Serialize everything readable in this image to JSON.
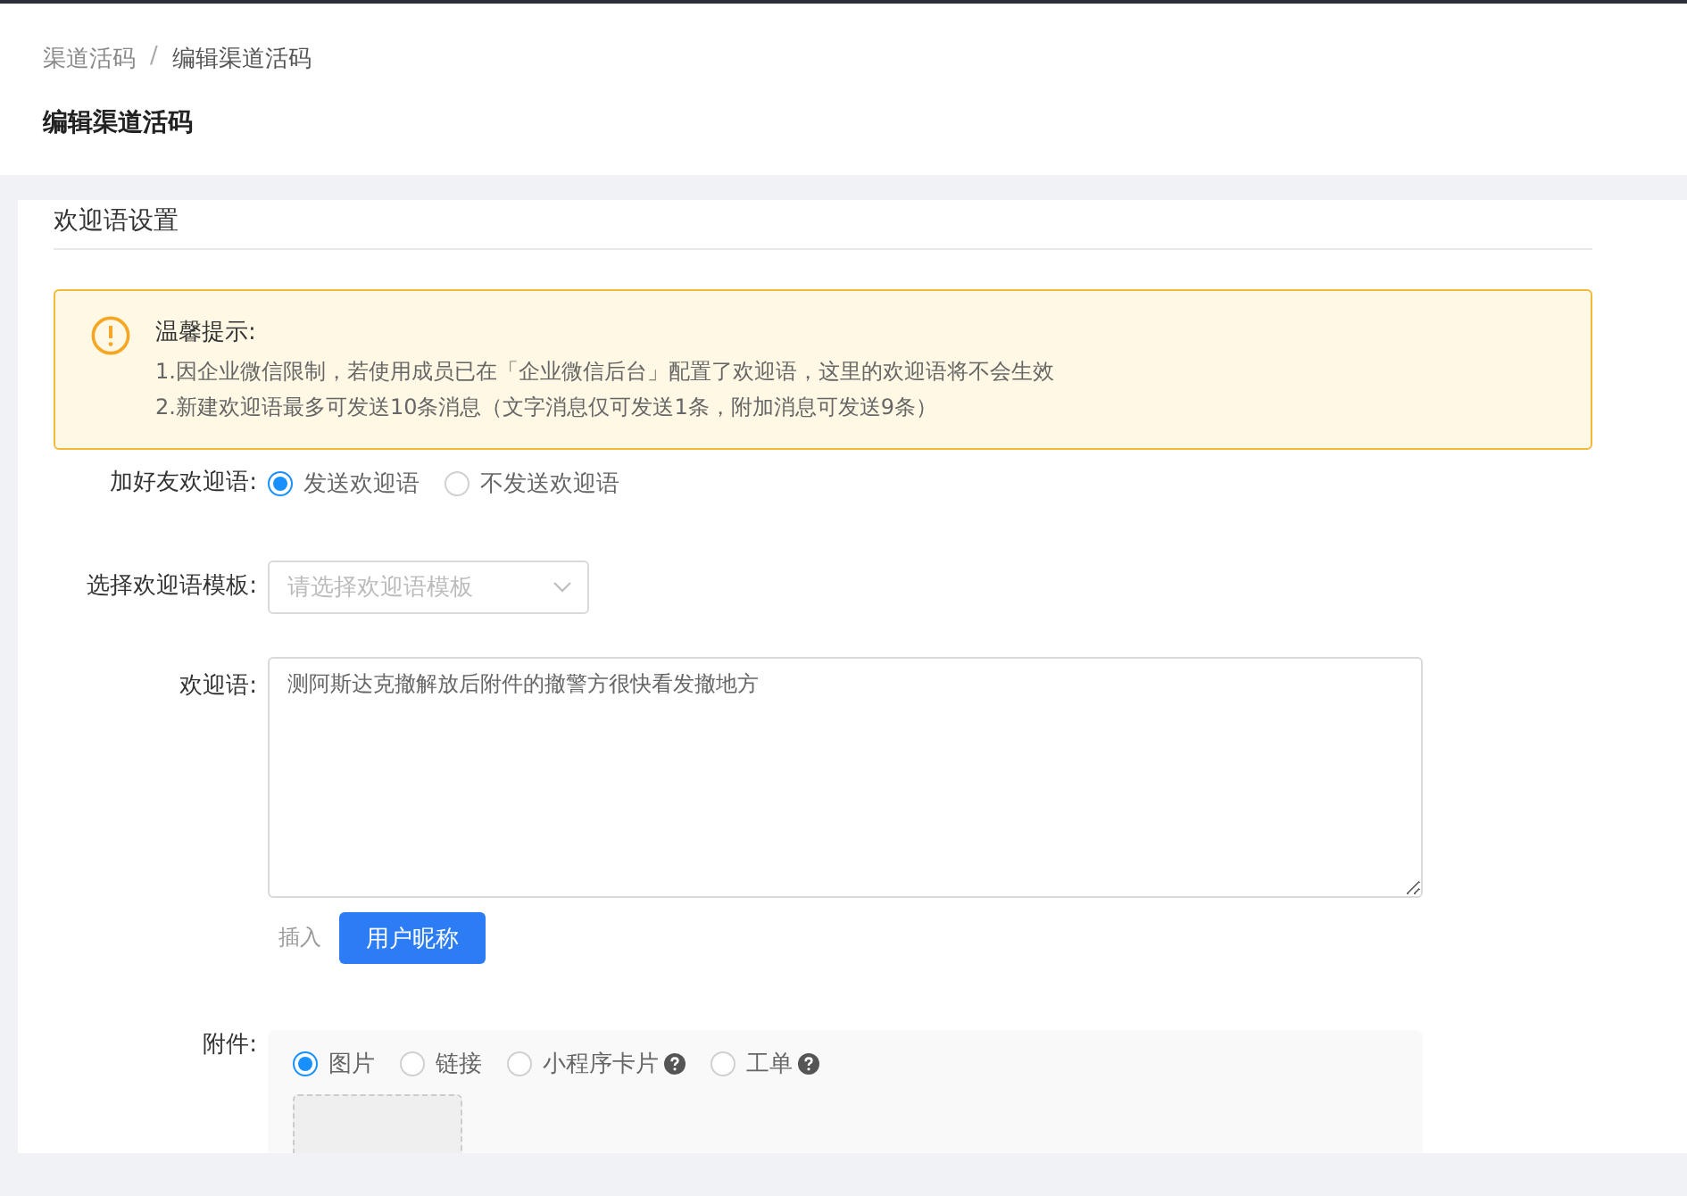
{
  "breadcrumb": {
    "items": [
      {
        "label": "渠道活码",
        "current": false
      },
      {
        "label": "编辑渠道活码",
        "current": true
      }
    ],
    "separator": "/"
  },
  "page_title": "编辑渠道活码",
  "section_title": "欢迎语设置",
  "notice": {
    "title": "温馨提示:",
    "lines": [
      "1.因企业微信限制，若使用成员已在「企业微信后台」配置了欢迎语，这里的欢迎语将不会生效",
      "2.新建欢迎语最多可发送10条消息（文字消息仅可发送1条，附加消息可发送9条）"
    ]
  },
  "welcome_toggle": {
    "label": "加好友欢迎语:",
    "options": [
      {
        "label": "发送欢迎语",
        "selected": true
      },
      {
        "label": "不发送欢迎语",
        "selected": false
      }
    ]
  },
  "template": {
    "label": "选择欢迎语模板:",
    "placeholder": "请选择欢迎语模板"
  },
  "welcome": {
    "label": "欢迎语:",
    "value": "测阿斯达克撤解放后附件的撤警方很快看发撤地方"
  },
  "insert": {
    "label": "插入",
    "button": "用户昵称"
  },
  "attachment": {
    "label": "附件:",
    "options": [
      {
        "label": "图片",
        "selected": true,
        "help": false
      },
      {
        "label": "链接",
        "selected": false,
        "help": false
      },
      {
        "label": "小程序卡片",
        "selected": false,
        "help": true
      },
      {
        "label": "工单",
        "selected": false,
        "help": true
      }
    ]
  }
}
